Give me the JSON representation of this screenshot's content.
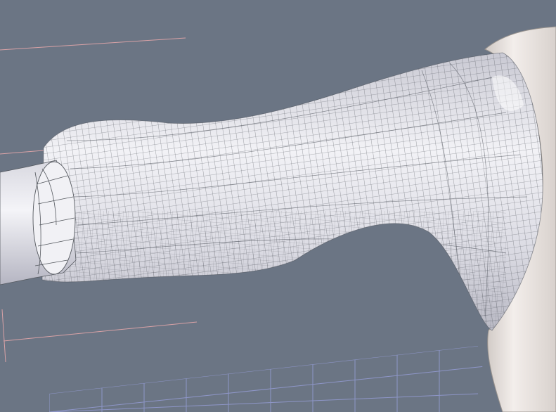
{
  "viewport": {
    "background": "#6b7584",
    "mesh_color": "#3a3f47",
    "surface_color": "#e9e8ee",
    "shoulder_color": "#ece6e2",
    "guide_line_color": "#d9a2a6",
    "floor_grid_color": "#8e96c8"
  }
}
